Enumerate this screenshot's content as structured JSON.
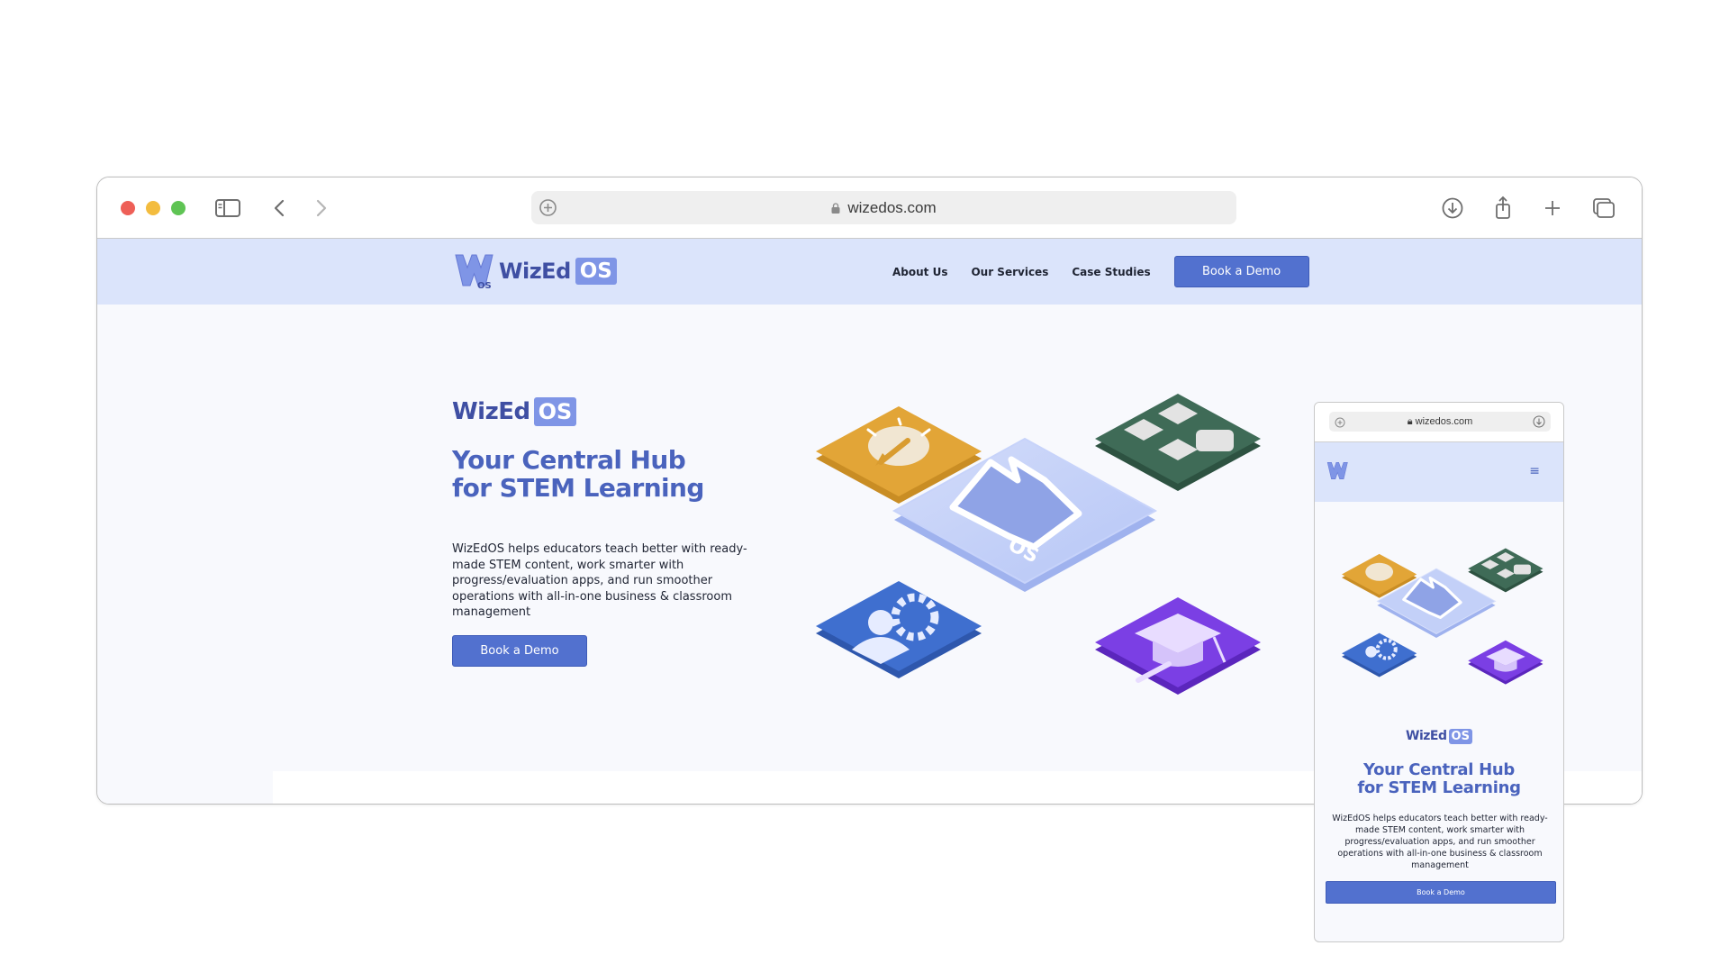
{
  "browser": {
    "url": "wizedos.com",
    "icons": [
      "sidebar-icon",
      "back-icon",
      "forward-icon",
      "plus-icon",
      "lock-icon",
      "download-icon",
      "share-icon",
      "new-tab-icon",
      "tabs-overview-icon"
    ]
  },
  "brand": {
    "name": "WizEd",
    "suffix": "OS",
    "logo_badge": "OS"
  },
  "nav": {
    "links": [
      "About Us",
      "Our Services",
      "Case Studies"
    ],
    "cta": "Book a Demo"
  },
  "hero": {
    "title_line1": "Your Central Hub",
    "title_line2": "for STEM Learning",
    "description": "WizEdOS helps educators teach better with ready-made STEM content, work smarter with progress/evaluation apps, and run smoother operations with all-in-one business & classroom management",
    "cta": "Book a Demo",
    "art_icons": [
      "lightbulb-pencil-icon",
      "grid-apps-icon",
      "wizedos-logo-tile",
      "users-gear-icon",
      "graduation-cap-icon"
    ]
  },
  "mobile": {
    "url": "wizedos.com",
    "menu_icon": "≡"
  },
  "colors": {
    "brand_blue": "#4a63bd",
    "nav_bg": "#dbe4fb",
    "button": "#5271cf",
    "os_badge": "#7f95e6",
    "tile_orange": "#e2a537",
    "tile_green": "#3f6b57",
    "tile_blue": "#3f6fcf",
    "tile_purple": "#7b3fe4"
  }
}
